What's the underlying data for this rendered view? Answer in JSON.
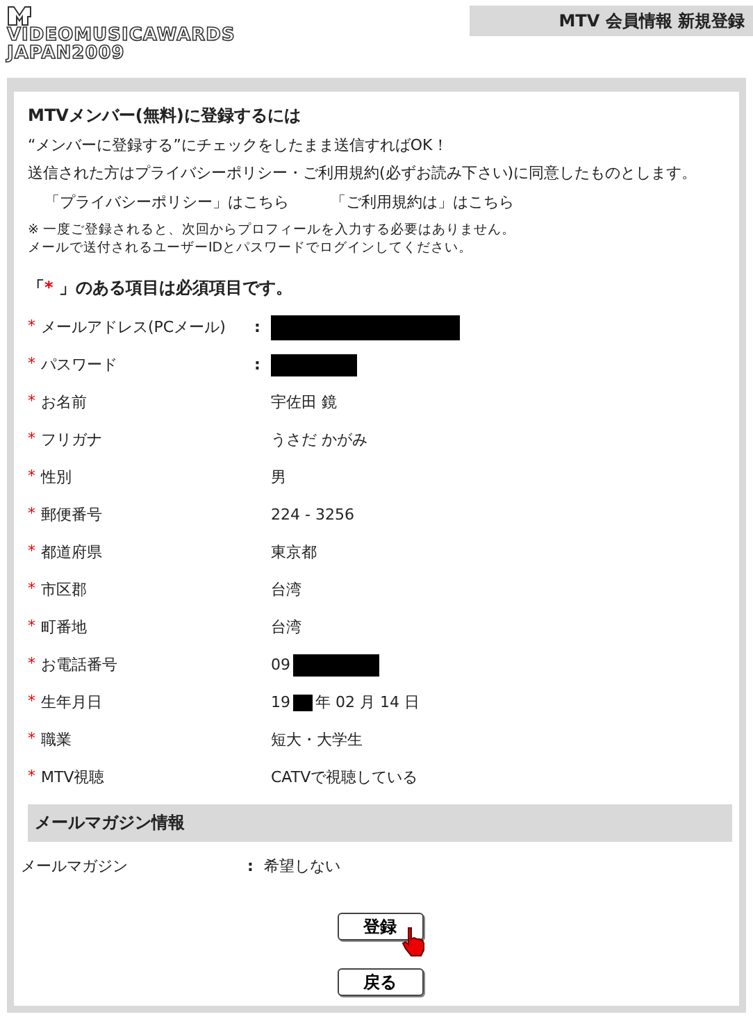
{
  "header": {
    "logo_lines": [
      "VIDEOMUSICAWARDS",
      "JAPAN2009"
    ],
    "page_title": "MTV 会員情報 新規登録"
  },
  "intro": {
    "title": "MTVメンバー(無料)に登録するには",
    "lines": [
      "“メンバーに登録する”にチェックをしたまま送信すればOK！",
      "送信された方はプライバシーポリシー・ご利用規約(必ずお読み下さい)に同意したものとします。"
    ],
    "links": [
      "「プライバシーポリシー」はこちら",
      "「ご利用規約は」はこちら"
    ],
    "notes": [
      "※ 一度ご登録されると、次回からプロフィールを入力する必要はありません。",
      "メールで送付されるユーザーIDとパスワードでログインしてください。"
    ],
    "required_before": "「",
    "required_mark": "*",
    "required_after": "」のある項目は必須項目です。"
  },
  "fields": [
    {
      "label": "メールアドレス(PCメール)",
      "required": true,
      "colon": ":",
      "segments": [
        {
          "kind": "mask-wide"
        }
      ]
    },
    {
      "label": "パスワード",
      "required": true,
      "colon": ":",
      "segments": [
        {
          "kind": "mask-medium"
        }
      ]
    },
    {
      "label": "お名前",
      "required": true,
      "segments": [
        {
          "kind": "text",
          "text": "宇佐田 鏡"
        }
      ]
    },
    {
      "label": "フリガナ",
      "required": true,
      "segments": [
        {
          "kind": "text",
          "text": "うさだ かがみ"
        }
      ]
    },
    {
      "label": "性別",
      "required": true,
      "segments": [
        {
          "kind": "text",
          "text": "男"
        }
      ]
    },
    {
      "label": "郵便番号",
      "required": true,
      "segments": [
        {
          "kind": "text",
          "text": "224 - 3256"
        }
      ]
    },
    {
      "label": "都道府県",
      "required": true,
      "segments": [
        {
          "kind": "text",
          "text": "東京都"
        }
      ]
    },
    {
      "label": "市区郡",
      "required": true,
      "segments": [
        {
          "kind": "text",
          "text": "台湾"
        }
      ]
    },
    {
      "label": "町番地",
      "required": true,
      "segments": [
        {
          "kind": "text",
          "text": "台湾"
        }
      ]
    },
    {
      "label": "お電話番号",
      "required": true,
      "segments": [
        {
          "kind": "text",
          "text": "09"
        },
        {
          "kind": "mask-medium"
        }
      ]
    },
    {
      "label": "生年月日",
      "required": true,
      "segments": [
        {
          "kind": "text",
          "text": "19"
        },
        {
          "kind": "mask-narrow"
        },
        {
          "kind": "text",
          "text": "年 02 月 14 日"
        }
      ]
    },
    {
      "label": "職業",
      "required": true,
      "segments": [
        {
          "kind": "text",
          "text": "短大・大学生"
        }
      ]
    },
    {
      "label": "MTV視聴",
      "required": true,
      "segments": [
        {
          "kind": "text",
          "text": "CATVで視聴している"
        }
      ]
    }
  ],
  "magazine": {
    "heading": "メールマガジン情報",
    "label": "メールマガジン",
    "colon": ":",
    "value": "希望しない"
  },
  "buttons": [
    "登録",
    "戻る"
  ]
}
